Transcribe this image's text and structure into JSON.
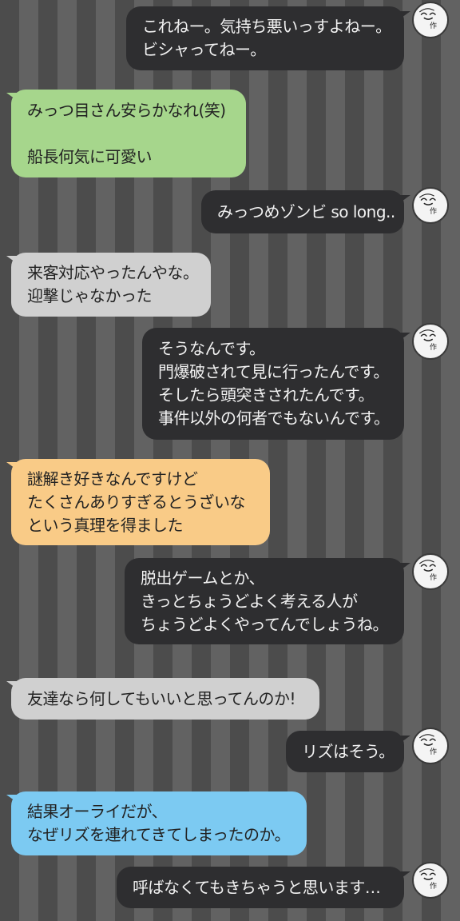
{
  "messages": [
    {
      "side": "right",
      "lines": [
        "これねー。気持ち悪いっすよねー。",
        "ビシャってねー。"
      ],
      "avatar_mark": "作"
    },
    {
      "side": "left",
      "color": "green",
      "lines": [
        "みっつ目さん安らかなれ(笑)",
        "",
        "船長何気に可愛い"
      ]
    },
    {
      "side": "right",
      "lines": [
        "みっつめゾンビ so long.."
      ],
      "avatar_mark": "作"
    },
    {
      "side": "left",
      "color": "grey",
      "lines": [
        "来客対応やったんやな。",
        "迎撃じゃなかった"
      ]
    },
    {
      "side": "right",
      "lines": [
        "そうなんです。",
        "門爆破されて見に行ったんです。",
        "そしたら頭突きされたんです。",
        "事件以外の何者でもないんです。"
      ],
      "avatar_mark": "作"
    },
    {
      "side": "left",
      "color": "orange",
      "lines": [
        "謎解き好きなんですけど",
        "たくさんありすぎるとうざいな",
        "という真理を得ました"
      ]
    },
    {
      "side": "right",
      "lines": [
        "脱出ゲームとか、",
        "きっとちょうどよく考える人が",
        "ちょうどよくやってんでしょうね。"
      ],
      "avatar_mark": "作"
    },
    {
      "side": "left",
      "color": "grey",
      "lines": [
        "友達なら何してもいいと思ってんのか!"
      ]
    },
    {
      "side": "right",
      "lines": [
        "リズはそう。"
      ],
      "avatar_mark": "作"
    },
    {
      "side": "left",
      "color": "blue",
      "lines": [
        "結果オーライだが、",
        "なぜリズを連れてきてしまったのか。"
      ]
    },
    {
      "side": "right",
      "lines": [
        "呼ばなくてもきちゃうと思います…"
      ],
      "avatar_mark": "作"
    }
  ],
  "colors": {
    "dark_bubble": "#2e2e30",
    "green_bubble": "#a6d68c",
    "grey_bubble": "#d0d0d0",
    "orange_bubble": "#f9cb87",
    "blue_bubble": "#7ccaf2"
  },
  "avatar_icon": "smiling-face-avatar-icon"
}
